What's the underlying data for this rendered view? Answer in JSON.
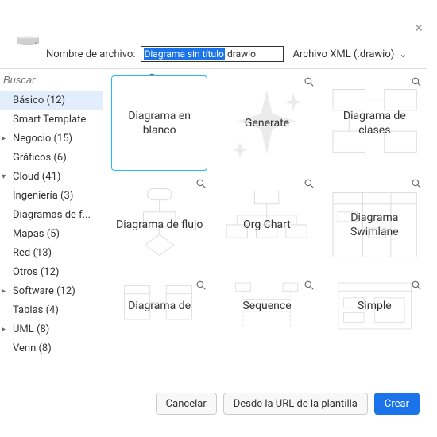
{
  "filename_label": "Nombre de archivo:",
  "filename_selected": "Diagrama sin título",
  "filename_ext": ".drawio",
  "format_label": "Archivo XML (.drawio)",
  "search_placeholder": "Buscar",
  "categories": [
    {
      "label": "Básico (12)",
      "selected": true,
      "expandable": false
    },
    {
      "label": "Smart Template",
      "expandable": false
    },
    {
      "label": "Negocio (15)",
      "expandable": true
    },
    {
      "label": "Gráficos (6)",
      "expandable": false
    },
    {
      "label": "Cloud (41)",
      "expandable": true,
      "expanded": true
    },
    {
      "label": "Ingeniería (3)",
      "expandable": false
    },
    {
      "label": "Diagramas de f...",
      "expandable": false
    },
    {
      "label": "Mapas (5)",
      "expandable": false
    },
    {
      "label": "Red (13)",
      "expandable": false
    },
    {
      "label": "Otros (12)",
      "expandable": false
    },
    {
      "label": "Software (12)",
      "expandable": true
    },
    {
      "label": "Tablas (4)",
      "expandable": false
    },
    {
      "label": "UML (8)",
      "expandable": true
    },
    {
      "label": "Venn (8)",
      "expandable": false
    }
  ],
  "templates_row1": [
    {
      "title": "Diagrama en blanco",
      "blank": true,
      "mag": false,
      "thumb": "none"
    },
    {
      "title": "Generate",
      "mag": true,
      "thumb": "sparkle"
    },
    {
      "title": "Diagrama de clases",
      "mag": true,
      "thumb": "class"
    }
  ],
  "templates_row2": [
    {
      "title": "Diagrama de flujo",
      "mag": true,
      "thumb": "flow"
    },
    {
      "title": "Org Chart",
      "mag": true,
      "thumb": "org"
    },
    {
      "title": "Diagrama Swimlane",
      "mag": true,
      "thumb": "swim"
    }
  ],
  "templates_row3": [
    {
      "title": "Diagrama de",
      "mag": true,
      "thumb": "er"
    },
    {
      "title": "Sequence",
      "mag": true,
      "thumb": "seq"
    },
    {
      "title": "Simple",
      "mag": true,
      "thumb": "simple"
    }
  ],
  "buttons": {
    "cancel": "Cancelar",
    "fromurl": "Desde la URL de la plantilla",
    "create": "Crear"
  }
}
